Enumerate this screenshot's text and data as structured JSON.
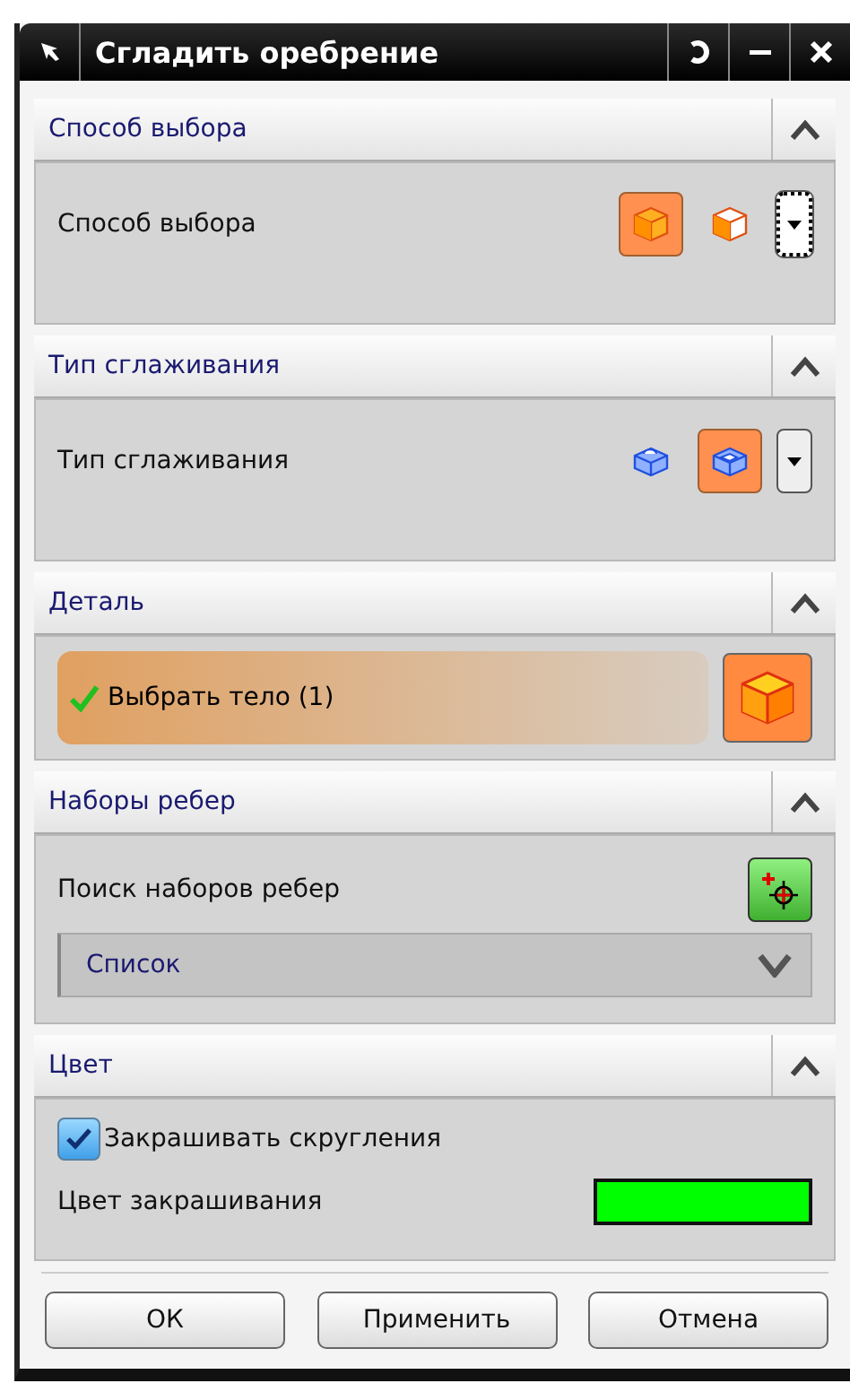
{
  "window": {
    "title": "Сгладить оребрение"
  },
  "sections": [
    {
      "kind": "options",
      "title": "Способ выбора",
      "expanded": true,
      "label": "Способ выбора",
      "options": [
        {
          "kind": "cube",
          "selected": true
        },
        {
          "kind": "cube_light",
          "selected": false
        }
      ],
      "dropdown_focused": true
    },
    {
      "kind": "options",
      "title": "Тип сглаживания",
      "expanded": true,
      "label": "Тип сглаживания",
      "options": [
        {
          "kind": "part_small",
          "selected": false
        },
        {
          "kind": "part_step",
          "selected": true
        }
      ],
      "dropdown_focused": false
    },
    {
      "kind": "selection",
      "title": "Деталь",
      "expanded": true,
      "label": "Выбрать тело (1)",
      "complete": true
    },
    {
      "kind": "edge_sets",
      "title": "Наборы ребер",
      "expanded": true,
      "label": "Поиск наборов ребер",
      "list_value": "Список"
    },
    {
      "kind": "color",
      "title": "Цвет",
      "expanded": true,
      "checkbox_label": "Закрашивать скругления",
      "checked": true,
      "swatch_label": "Цвет закрашивания",
      "color": "#00ff00"
    }
  ],
  "buttons": [
    "ОК",
    "Применить",
    "Отмена"
  ]
}
